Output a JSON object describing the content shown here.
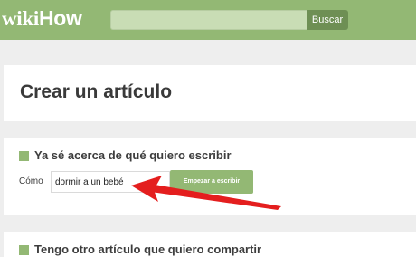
{
  "header": {
    "logo_wiki": "wiki",
    "logo_how": "How",
    "search_placeholder": "",
    "search_button_label": "Buscar"
  },
  "page_title": "Crear un artículo",
  "section_write": {
    "heading": "Ya sé acerca de qué quiero escribir",
    "label": "Cómo",
    "input_value": "dormir a un bebé",
    "button_label": "Empezar a escribir"
  },
  "section_share": {
    "heading": "Tengo otro artículo que quiero compartir"
  },
  "colors": {
    "brand_green": "#93b874",
    "header_button": "#6e8f54",
    "annotation_arrow": "#e41e1e"
  },
  "icons": [
    "section-square-icon",
    "red-annotation-arrow-icon"
  ]
}
